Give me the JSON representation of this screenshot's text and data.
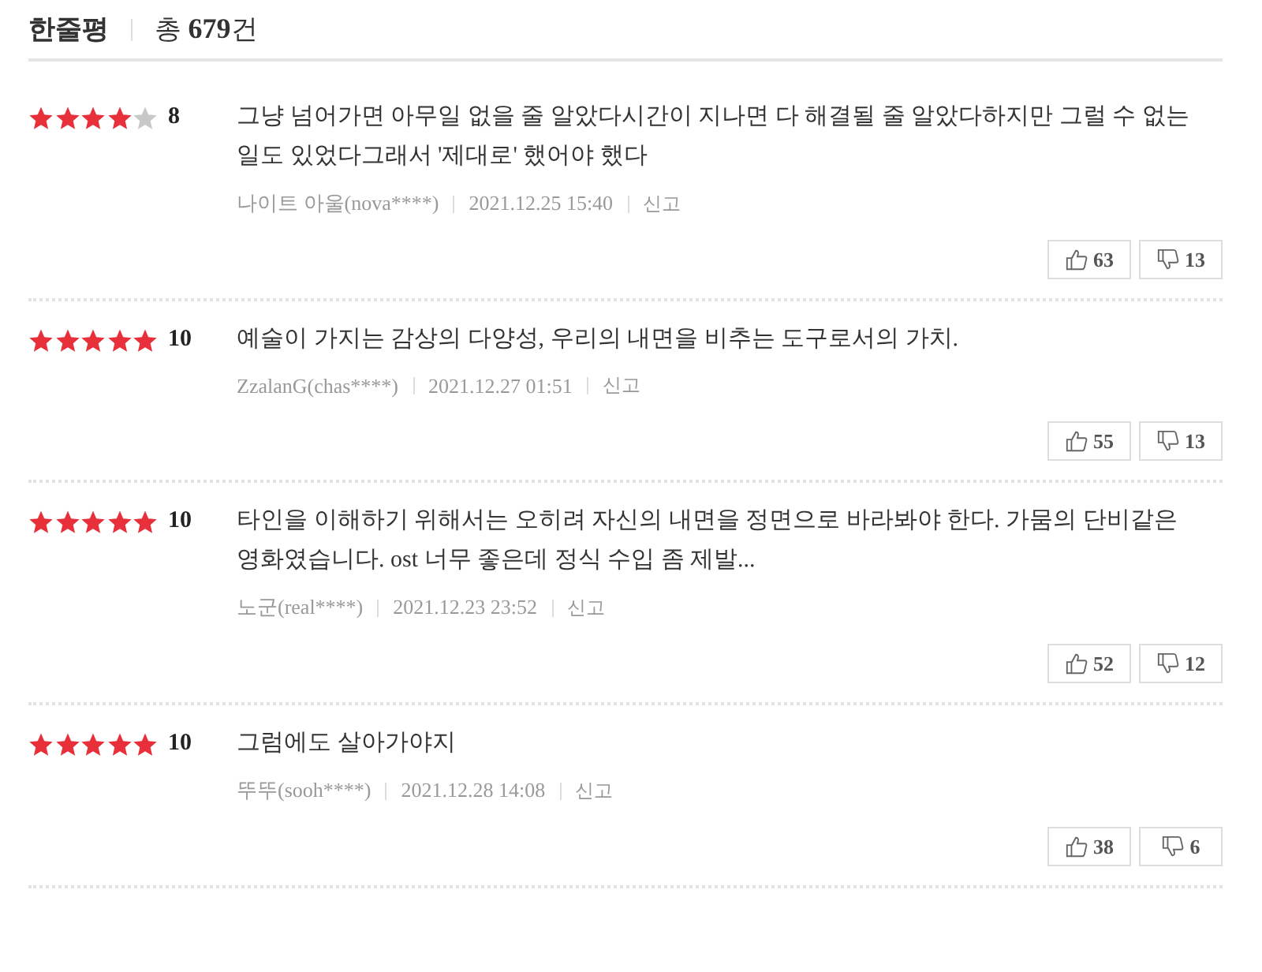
{
  "header": {
    "title": "한줄평",
    "total_label": "총",
    "total_count": "679",
    "total_unit": "건"
  },
  "reviews": [
    {
      "stars": 4,
      "score": "8",
      "text": "그냥 넘어가면 아무일 없을 줄 알았다시간이 지나면 다 해결될 줄 알았다하지만 그럴 수 없는 일도 있었다그래서 '제대로' 했어야 했다",
      "author": "나이트 아울(nova****)",
      "date": "2021.12.25 15:40",
      "report": "신고",
      "likes": "63",
      "dislikes": "13"
    },
    {
      "stars": 5,
      "score": "10",
      "text": "예술이 가지는 감상의 다양성, 우리의 내면을 비추는 도구로서의 가치.",
      "author": "ZzalanG(chas****)",
      "date": "2021.12.27 01:51",
      "report": "신고",
      "likes": "55",
      "dislikes": "13"
    },
    {
      "stars": 5,
      "score": "10",
      "text": "타인을 이해하기 위해서는 오히려 자신의 내면을 정면으로 바라봐야 한다. 가뭄의 단비같은 영화였습니다. ost 너무 좋은데 정식 수입 좀 제발...",
      "author": "노군(real****)",
      "date": "2021.12.23 23:52",
      "report": "신고",
      "likes": "52",
      "dislikes": "12"
    },
    {
      "stars": 5,
      "score": "10",
      "text": "그럼에도 살아가야지",
      "author": "뚜뚜(sooh****)",
      "date": "2021.12.28 14:08",
      "report": "신고",
      "likes": "38",
      "dislikes": "6"
    }
  ]
}
